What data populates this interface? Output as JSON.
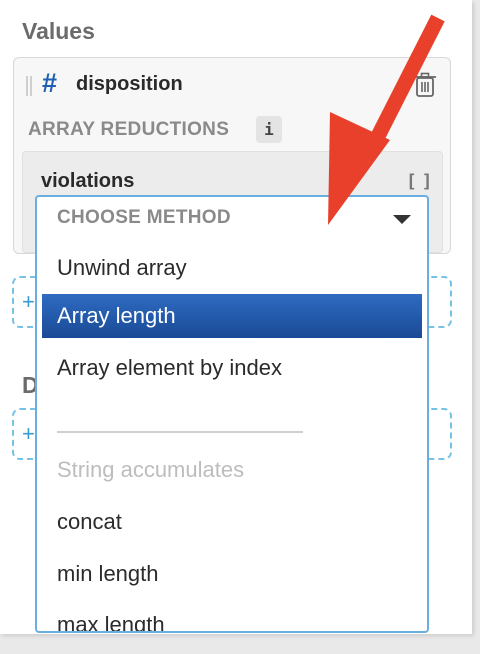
{
  "values_section": {
    "title": "Values",
    "field": {
      "icon": "hash-icon",
      "name": "disposition"
    },
    "array_reductions_label": "ARRAY REDUCTIONS",
    "info_badge": "i",
    "reduction": {
      "name": "violations",
      "icon": "array-brackets-icon"
    },
    "add_button": "+"
  },
  "second_section": {
    "title_visible_letter": "D",
    "add_button": "+"
  },
  "dropdown": {
    "header": "CHOOSE METHOD",
    "options": [
      {
        "label": "Unwind array"
      },
      {
        "label": "Array length",
        "selected": true
      },
      {
        "label": "Array element by index"
      }
    ],
    "group_header": "String accumulates",
    "string_options": [
      {
        "label": "concat"
      },
      {
        "label": "min length"
      },
      {
        "label": "max length"
      }
    ]
  },
  "colors": {
    "accent": "#1f5fb0",
    "selected_bg": "#1f54a8",
    "dropdown_border": "#6aaee0",
    "annotation_arrow": "#e8402a"
  }
}
